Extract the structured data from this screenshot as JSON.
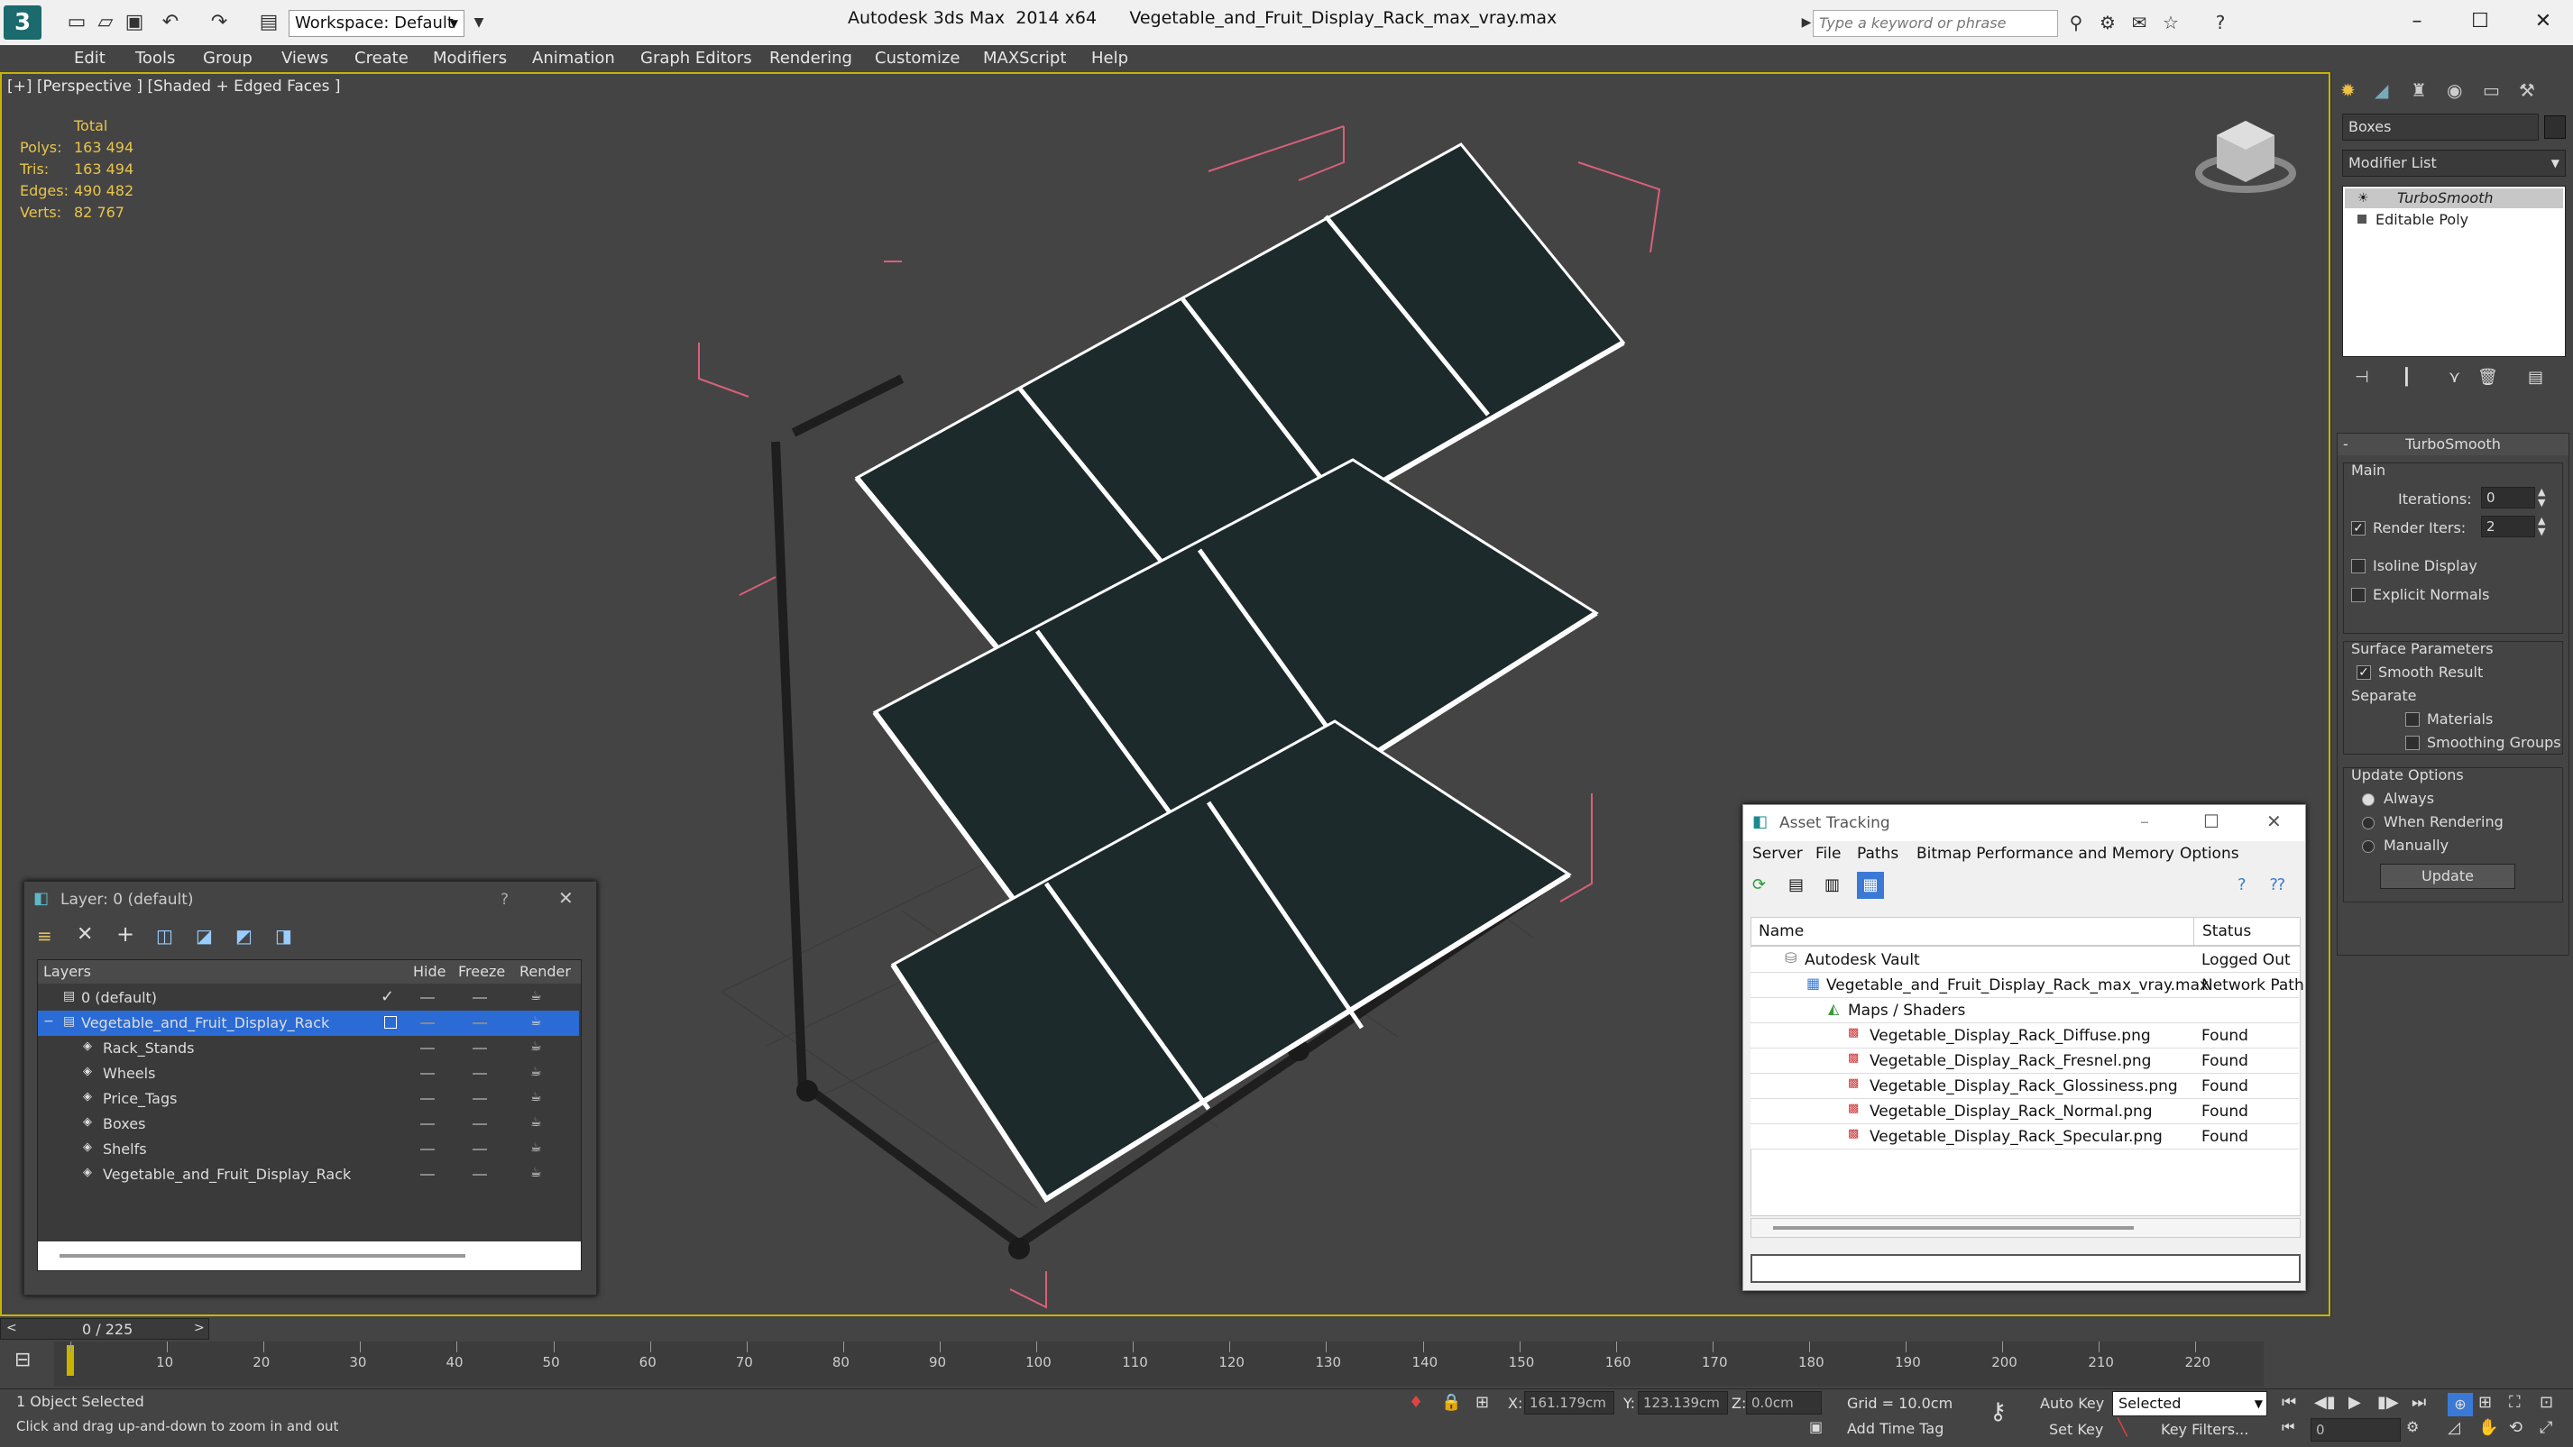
{
  "app": {
    "name": "Autodesk 3ds Max  2014 x64",
    "file": "Vegetable_and_Fruit_Display_Rack_max_vray.max",
    "workspace": "Workspace: Default",
    "search_placeholder": "Type a keyword or phrase"
  },
  "menu": [
    "Edit",
    "Tools",
    "Group",
    "Views",
    "Create",
    "Modifiers",
    "Animation",
    "Graph Editors",
    "Rendering",
    "Customize",
    "MAXScript",
    "Help"
  ],
  "viewport": {
    "label": "[+] [Perspective ] [Shaded + Edged Faces ]",
    "stats": {
      "header": "Total",
      "rows": [
        {
          "label": "Polys:",
          "value": "163 494"
        },
        {
          "label": "Tris:",
          "value": "163 494"
        },
        {
          "label": "Edges:",
          "value": "490 482"
        },
        {
          "label": "Verts:",
          "value": "82 767"
        }
      ]
    }
  },
  "command_panel": {
    "object_name": "Boxes",
    "modifier_list": "Modifier List",
    "stack": [
      "TurboSmooth",
      "Editable Poly"
    ],
    "rollout_title": "TurboSmooth",
    "main_label": "Main",
    "iterations_label": "Iterations:",
    "iterations_value": "0",
    "render_iters_label": "Render Iters:",
    "render_iters_value": "2",
    "isoline_label": "Isoline Display",
    "explicit_normals_label": "Explicit Normals",
    "surface_params_label": "Surface Parameters",
    "smooth_result_label": "Smooth Result",
    "separate_label": "Separate",
    "materials_label": "Materials",
    "smoothing_groups_label": "Smoothing Groups",
    "update_options_label": "Update Options",
    "always_label": "Always",
    "when_rendering_label": "When Rendering",
    "manually_label": "Manually",
    "update_button": "Update"
  },
  "layer_dialog": {
    "title": "Layer: 0 (default)",
    "help": "?",
    "columns": {
      "layers": "Layers",
      "hide": "Hide",
      "freeze": "Freeze",
      "render": "Render"
    },
    "rows": [
      {
        "name": "0 (default)",
        "level": 1
      },
      {
        "name": "Vegetable_and_Fruit_Display_Rack",
        "level": 1,
        "selected": true
      },
      {
        "name": "Rack_Stands",
        "level": 2
      },
      {
        "name": "Wheels",
        "level": 2
      },
      {
        "name": "Price_Tags",
        "level": 2
      },
      {
        "name": "Boxes",
        "level": 2
      },
      {
        "name": "Shelfs",
        "level": 2
      },
      {
        "name": "Vegetable_and_Fruit_Display_Rack",
        "level": 2
      }
    ]
  },
  "asset_tracking": {
    "title": "Asset Tracking",
    "menu": [
      "Server",
      "File",
      "Paths",
      "Bitmap Performance and Memory",
      "Options"
    ],
    "columns": {
      "name": "Name",
      "status": "Status"
    },
    "rows": [
      {
        "name": "Autodesk Vault",
        "status": "Logged Out",
        "level": 1,
        "icon": "vault-icon"
      },
      {
        "name": "Vegetable_and_Fruit_Display_Rack_max_vray.max",
        "status": "Network Path",
        "level": 2,
        "icon": "max-file-icon"
      },
      {
        "name": "Maps / Shaders",
        "status": "",
        "level": 3,
        "icon": "maps-icon"
      },
      {
        "name": "Vegetable_Display_Rack_Diffuse.png",
        "status": "Found",
        "level": 4,
        "icon": "png-icon"
      },
      {
        "name": "Vegetable_Display_Rack_Fresnel.png",
        "status": "Found",
        "level": 4,
        "icon": "png-icon"
      },
      {
        "name": "Vegetable_Display_Rack_Glossiness.png",
        "status": "Found",
        "level": 4,
        "icon": "png-icon"
      },
      {
        "name": "Vegetable_Display_Rack_Normal.png",
        "status": "Found",
        "level": 4,
        "icon": "png-icon"
      },
      {
        "name": "Vegetable_Display_Rack_Specular.png",
        "status": "Found",
        "level": 4,
        "icon": "png-icon"
      }
    ]
  },
  "timeline": {
    "frame_counter": "0 / 225",
    "ticks": [
      "0",
      "10",
      "20",
      "30",
      "40",
      "50",
      "60",
      "70",
      "80",
      "90",
      "100",
      "110",
      "120",
      "130",
      "140",
      "150",
      "160",
      "170",
      "180",
      "190",
      "200",
      "210",
      "220"
    ]
  },
  "status": {
    "selection": "1 Object Selected",
    "prompt": "Click and drag up-and-down to zoom in and out",
    "x_label": "X:",
    "x_value": "161.179cm",
    "y_label": "Y:",
    "y_value": "123.139cm",
    "z_label": "Z:",
    "z_value": "0.0cm",
    "grid": "Grid = 10.0cm",
    "auto_key": "Auto Key",
    "auto_key_mode": "Selected",
    "set_key": "Set Key",
    "key_filters": "Key Filters...",
    "add_time_tag": "Add Time Tag",
    "current_frame": "0"
  },
  "colors": {
    "viewport_bg": "#444444",
    "stats_yellow": "#e8c44a",
    "selection_blue": "#2a6bd6",
    "gizmo_pink": "#e06080",
    "active_border": "#c8b400"
  }
}
